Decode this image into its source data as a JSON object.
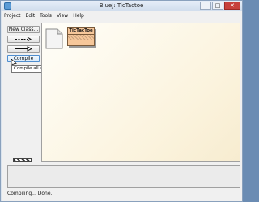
{
  "window": {
    "title": "BlueJ:  TicTactoe",
    "controls": {
      "minimize": "–",
      "maximize": "□",
      "close": "✕"
    }
  },
  "menubar": {
    "items": [
      "Project",
      "Edit",
      "Tools",
      "View",
      "Help"
    ]
  },
  "toolbar": {
    "new_class_label": "New Class...",
    "uses_arrow_label": "--->",
    "inherits_arrow_label": "—▷",
    "compile_label": "Compile"
  },
  "tooltip": {
    "text": "Compile all uncompiled classes in this package"
  },
  "diagram": {
    "class_name": "TicTacToe"
  },
  "statusbar": {
    "text": "Compiling... Done."
  },
  "colors": {
    "class_fill": "#f6c79a",
    "canvas_bg": "#fdf6e3"
  }
}
